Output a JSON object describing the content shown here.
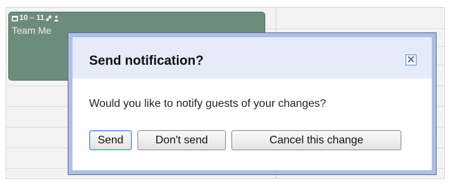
{
  "calendar_event": {
    "time": "10 – 11",
    "title": "Team Me",
    "icons": [
      "calendar-icon",
      "link-icon",
      "person-icon"
    ]
  },
  "dialog": {
    "title": "Send notification?",
    "message": "Would you like to notify guests of your changes?",
    "buttons": {
      "send": "Send",
      "dont_send": "Don't send",
      "cancel_change": "Cancel this change"
    },
    "close_icon": "close-icon"
  },
  "colors": {
    "event_bg": "#6e8c7e",
    "dialog_border": "#aebfe6",
    "dialog_header_bg": "#e6ebf9",
    "primary_focus": "#4d90fe"
  }
}
